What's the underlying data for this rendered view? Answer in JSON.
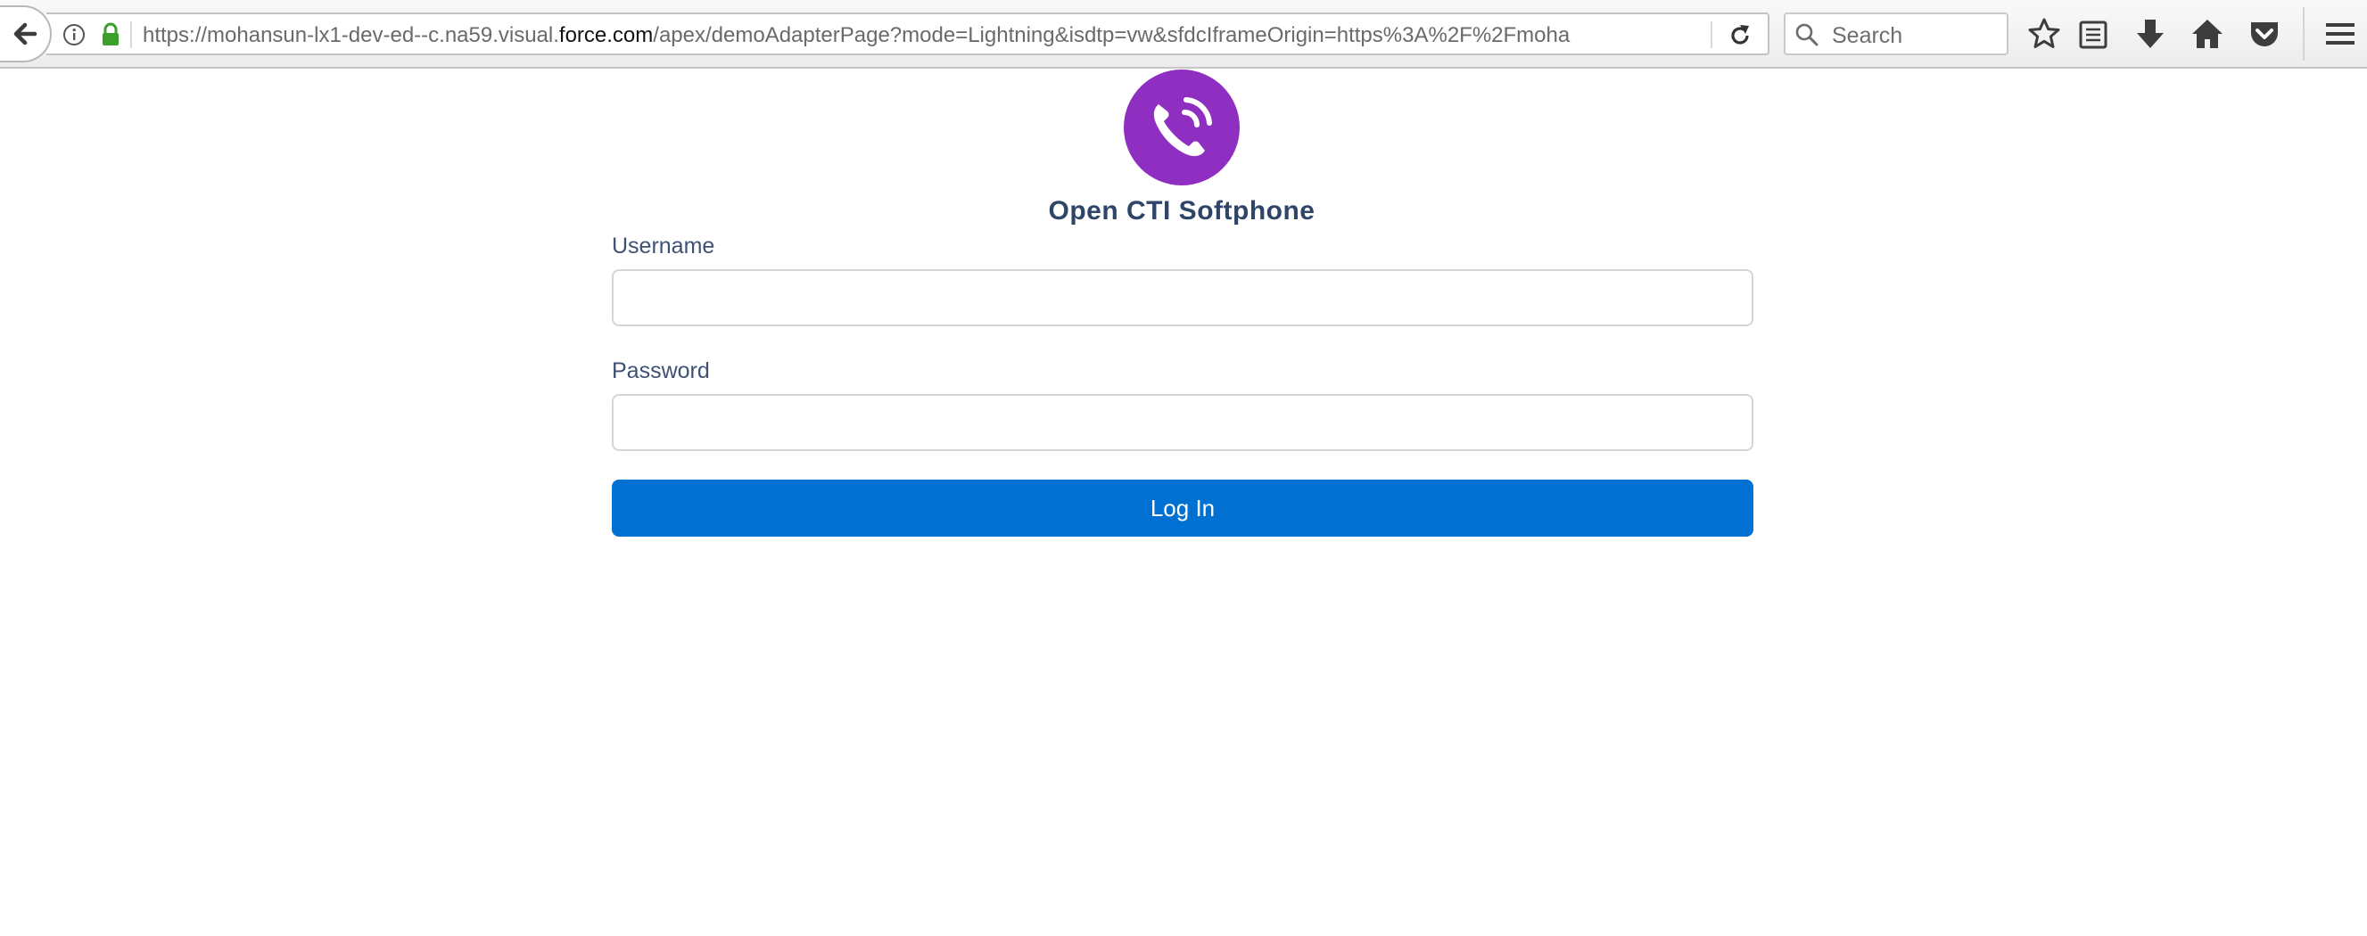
{
  "browser": {
    "url": {
      "prefix": "https://mohansun-lx1-dev-ed--c.na59.visual.",
      "domain": "force.com",
      "suffix": "/apex/demoAdapterPage?mode=Lightning&isdtp=vw&sfdcIframeOrigin=https%3A%2F%2Fmoha"
    },
    "search_placeholder": "Search",
    "icons": [
      "back-arrow-icon",
      "info-icon",
      "lock-icon",
      "reload-icon",
      "search-icon",
      "bookmark-star-icon",
      "reading-list-icon",
      "download-icon",
      "home-icon",
      "pocket-icon",
      "menu-icon"
    ]
  },
  "page": {
    "logo_icon": "phone-icon",
    "logo_color": "#8e2fc1",
    "title": "Open CTI  Softphone",
    "username_label": "Username",
    "username_value": "",
    "password_label": "Password",
    "password_value": "",
    "login_button": "Log In",
    "login_button_color": "#0070d2"
  }
}
